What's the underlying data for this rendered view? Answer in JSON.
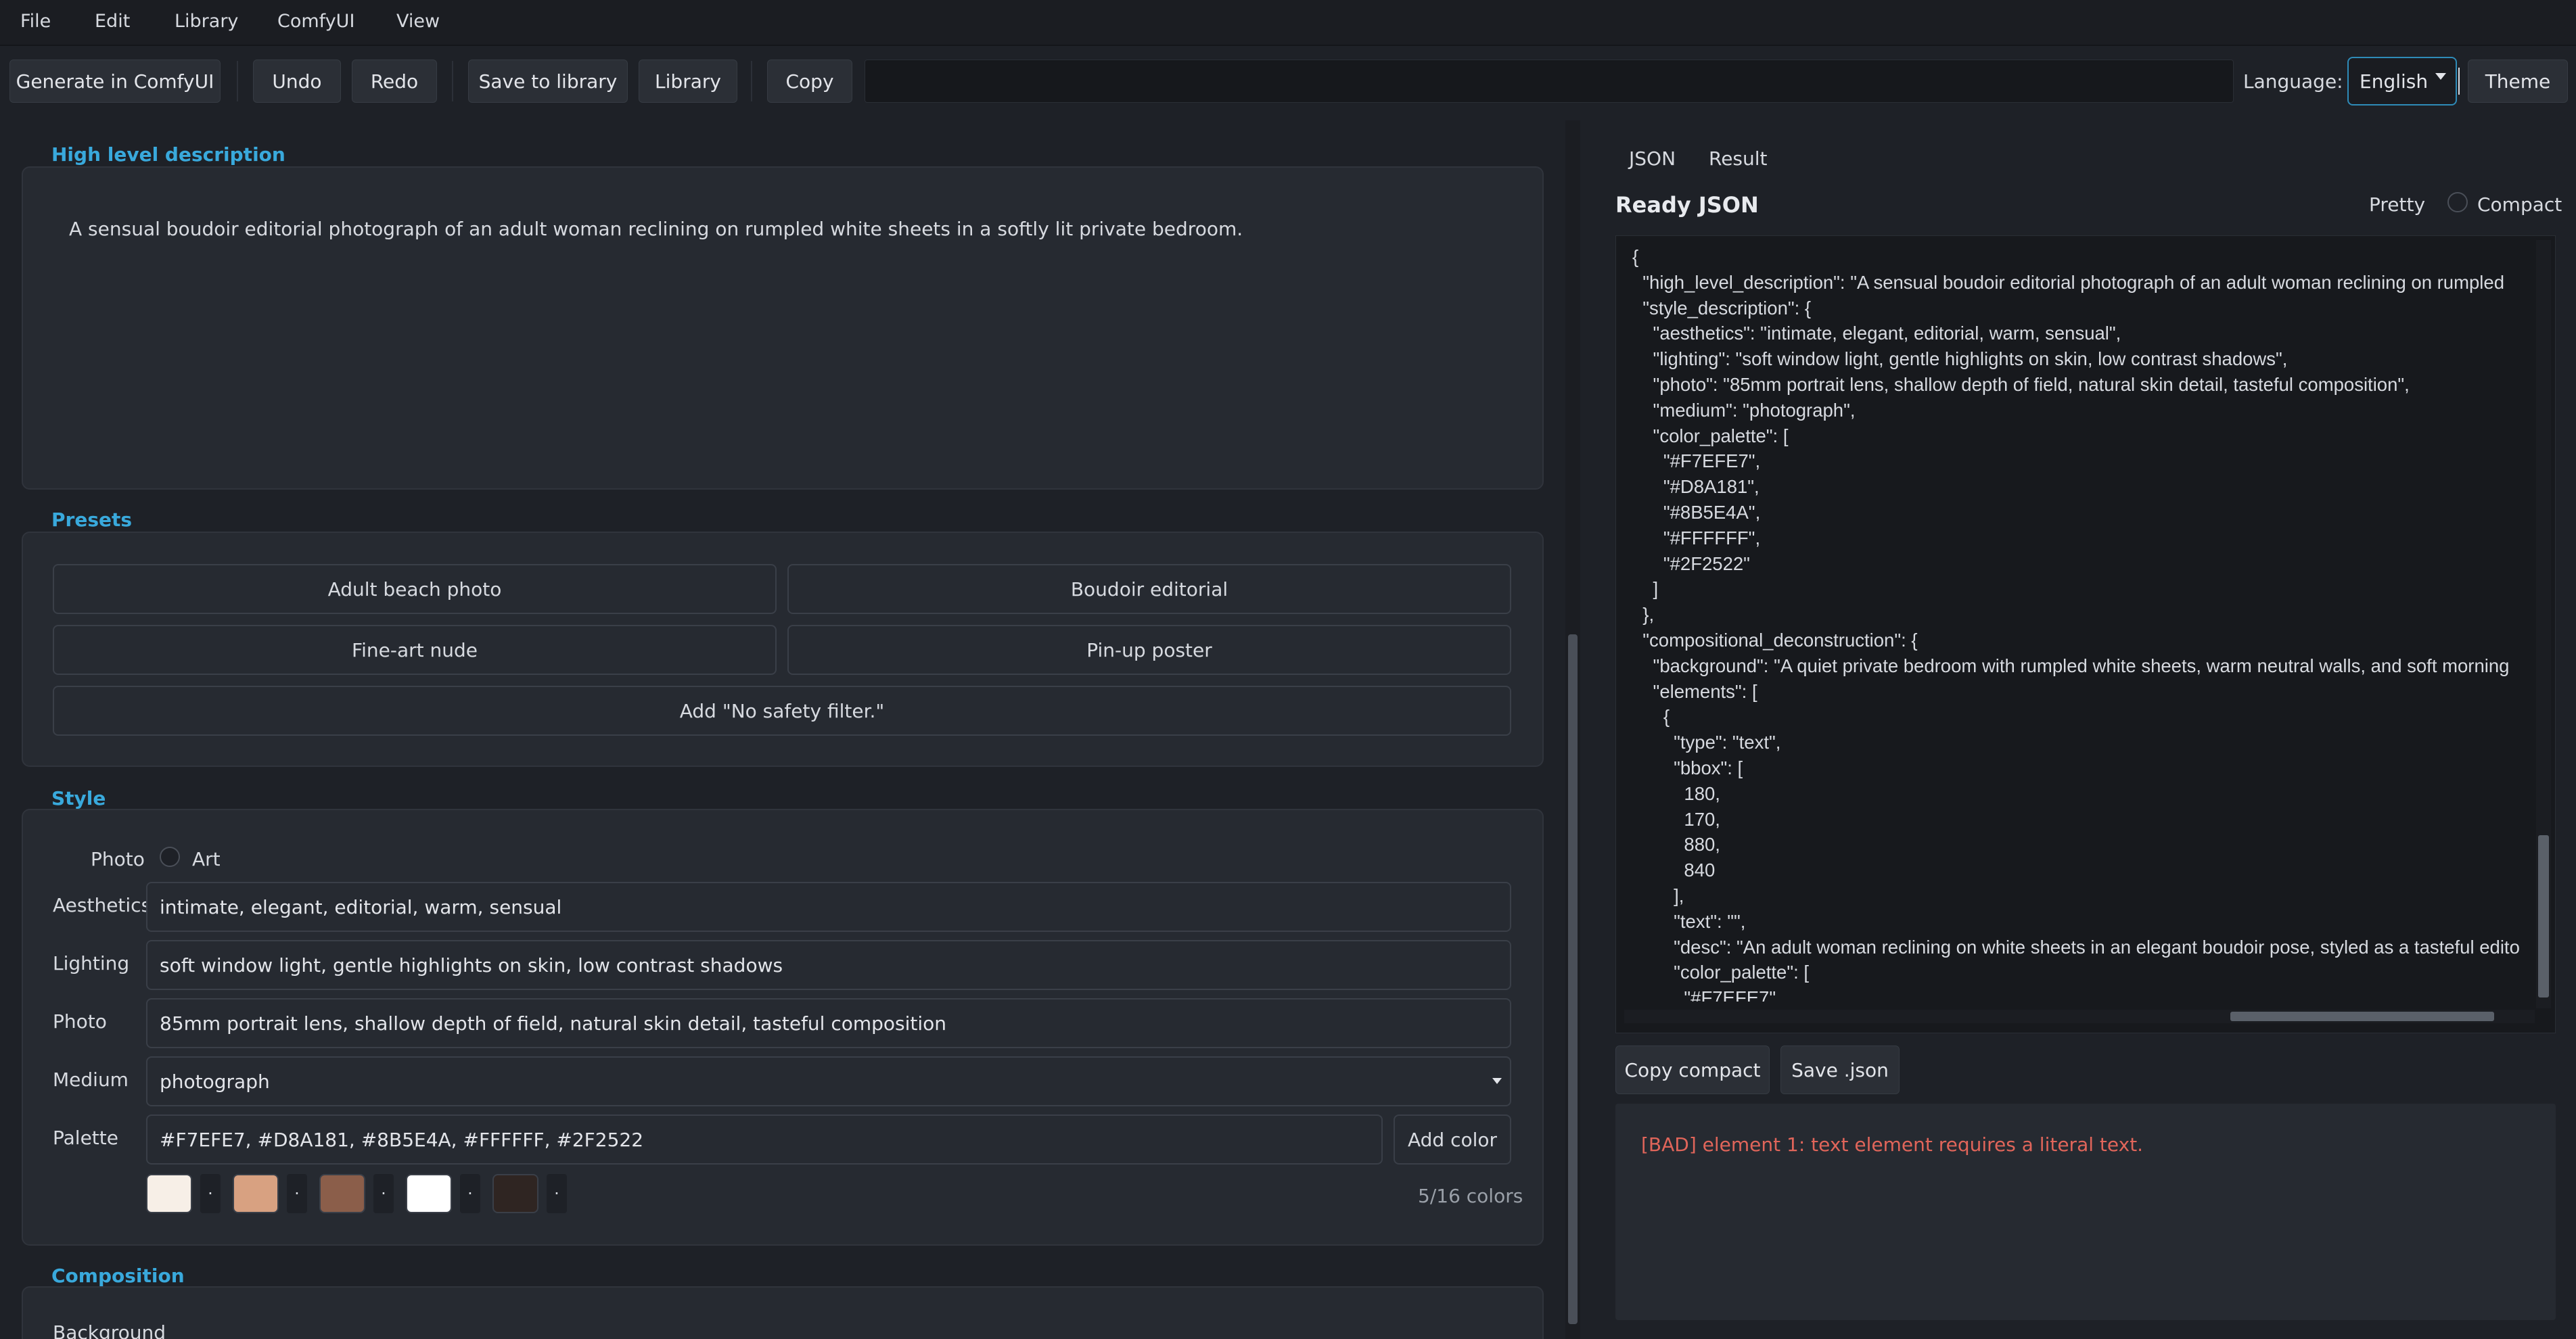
{
  "menu": [
    "File",
    "Edit",
    "Library",
    "ComfyUI",
    "View"
  ],
  "toolbar": {
    "generate": "Generate in ComfyUI",
    "undo": "Undo",
    "redo": "Redo",
    "save_library": "Save to library",
    "library": "Library",
    "copy": "Copy",
    "language_label": "Language:",
    "language_value": "English",
    "theme": "Theme"
  },
  "high_level": {
    "title": "High level description",
    "text": "A sensual boudoir editorial photograph of an adult woman reclining on rumpled white sheets in a softly lit private bedroom."
  },
  "presets": {
    "title": "Presets",
    "items": [
      "Adult beach photo",
      "Boudoir editorial",
      "Fine-art nude",
      "Pin-up poster",
      "Add \"No safety filter.\""
    ]
  },
  "style": {
    "title": "Style",
    "mode_photo": "Photo",
    "mode_art": "Art",
    "aesthetics_label": "Aesthetics",
    "aesthetics": "intimate, elegant, editorial, warm, sensual",
    "lighting_label": "Lighting",
    "lighting": "soft window light, gentle highlights on skin, low contrast shadows",
    "photo_label": "Photo",
    "photo": "85mm portrait lens, shallow depth of field, natural skin detail, tasteful composition",
    "medium_label": "Medium",
    "medium": "photograph",
    "palette_label": "Palette",
    "palette": "#F7EFE7, #D8A181, #8B5E4A, #FFFFFF, #2F2522",
    "add_color": "Add color",
    "swatches": [
      "#F7EFE7",
      "#D8A181",
      "#8B5E4A",
      "#FFFFFF",
      "#2F2522"
    ],
    "swatch_dot": "·",
    "color_count": "5/16 colors"
  },
  "composition": {
    "title": "Composition",
    "background_label": "Background"
  },
  "right": {
    "tab_json": "JSON",
    "tab_result": "Result",
    "ready_json": "Ready JSON",
    "pretty": "Pretty",
    "compact": "Compact",
    "json_lines": [
      "{",
      "  \"high_level_description\": \"A sensual boudoir editorial photograph of an adult woman reclining on rumpled",
      "  \"style_description\": {",
      "    \"aesthetics\": \"intimate, elegant, editorial, warm, sensual\",",
      "    \"lighting\": \"soft window light, gentle highlights on skin, low contrast shadows\",",
      "    \"photo\": \"85mm portrait lens, shallow depth of field, natural skin detail, tasteful composition\",",
      "    \"medium\": \"photograph\",",
      "    \"color_palette\": [",
      "      \"#F7EFE7\",",
      "      \"#D8A181\",",
      "      \"#8B5E4A\",",
      "      \"#FFFFFF\",",
      "      \"#2F2522\"",
      "    ]",
      "  },",
      "  \"compositional_deconstruction\": {",
      "    \"background\": \"A quiet private bedroom with rumpled white sheets, warm neutral walls, and soft morning",
      "    \"elements\": [",
      "      {",
      "        \"type\": \"text\",",
      "        \"bbox\": [",
      "          180,",
      "          170,",
      "          880,",
      "          840",
      "        ],",
      "        \"text\": \"\",",
      "        \"desc\": \"An adult woman reclining on white sheets in an elegant boudoir pose, styled as a tasteful edito",
      "        \"color_palette\": [",
      "          \"#F7EFE7\","
    ],
    "copy_compact": "Copy compact",
    "save_json": "Save .json",
    "error": "[BAD] element 1: text element requires a literal text."
  },
  "colors": {
    "accent": "#39a9dc",
    "error": "#e0655a",
    "background": "#1e2127"
  }
}
